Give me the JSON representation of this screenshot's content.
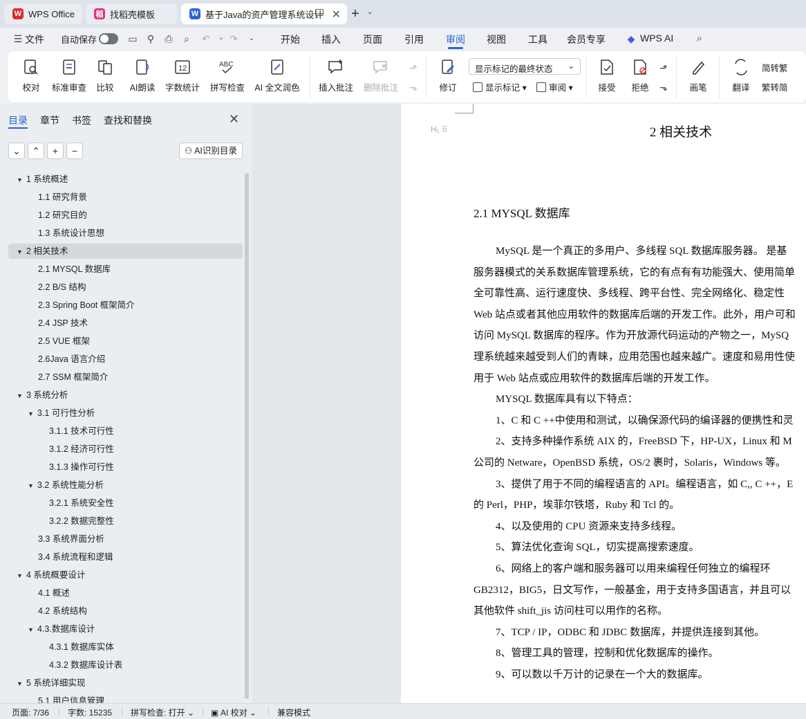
{
  "tabs": {
    "wps_office": "WPS Office",
    "templates": "找稻壳模板",
    "document": "基于Java的资产管理系统设计",
    "wps_color": "#e02b2b",
    "template_color": "#d9367a",
    "doc_color": "#2a64d8"
  },
  "menubar": {
    "file": "文件",
    "autosave": "自动保存",
    "items": [
      "开始",
      "插入",
      "页面",
      "引用",
      "审阅",
      "视图",
      "工具",
      "会员专享"
    ],
    "active": "审阅",
    "wps_ai": "WPS AI"
  },
  "ribbon": {
    "proofread": "校对",
    "standard_review": "标准审查",
    "compare": "比较",
    "ai_read": "AI朗读",
    "word_count": "字数统计",
    "spell_check": "拼写检查",
    "ai_polish": "AI 全文润色",
    "insert_comment": "插入批注",
    "delete_comment": "删除批注",
    "revise": "修订",
    "markup_dropdown": "显示标记的最终状态",
    "show_markup": "显示标记",
    "review_pane": "审阅",
    "accept": "接受",
    "reject": "拒绝",
    "pen": "画笔",
    "translate": "翻译",
    "to_traditional": "简转繁",
    "to_simplified": "繁转简"
  },
  "nav": {
    "tabs": [
      "目录",
      "章节",
      "书签",
      "查找和替换"
    ],
    "active_tab": "目录",
    "ai_toc": "AI识别目录",
    "toc": [
      {
        "level": 1,
        "text": "1 系统概述",
        "expand": true
      },
      {
        "level": 2,
        "text": "1.1  研究背景"
      },
      {
        "level": 2,
        "text": "1.2 研究目的"
      },
      {
        "level": 2,
        "text": "1.3 系统设计思想"
      },
      {
        "level": 1,
        "text": "2 相关技术",
        "expand": true,
        "selected": true
      },
      {
        "level": 2,
        "text": "2.1 MYSQL 数据库"
      },
      {
        "level": 2,
        "text": "2.2 B/S 结构"
      },
      {
        "level": 2,
        "text": "2.3 Spring Boot 框架简介"
      },
      {
        "level": 2,
        "text": "2.4 JSP 技术"
      },
      {
        "level": 2,
        "text": "2.5 VUE 框架"
      },
      {
        "level": 2,
        "text": "2.6Java 语言介绍"
      },
      {
        "level": 2,
        "text": "2.7 SSM 框架简介"
      },
      {
        "level": 1,
        "text": "3 系统分析",
        "expand": true
      },
      {
        "level": 2,
        "text": "3.1 可行性分析",
        "expand": true
      },
      {
        "level": 3,
        "text": "3.1.1 技术可行性"
      },
      {
        "level": 3,
        "text": "3.1.2 经济可行性"
      },
      {
        "level": 3,
        "text": "3.1.3 操作可行性"
      },
      {
        "level": 2,
        "text": "3.2 系统性能分析",
        "expand": true
      },
      {
        "level": 3,
        "text": "3.2.1  系统安全性"
      },
      {
        "level": 3,
        "text": "3.2.2  数据完整性"
      },
      {
        "level": 2,
        "text": "3.3 系统界面分析"
      },
      {
        "level": 2,
        "text": "3.4 系统流程和逻辑"
      },
      {
        "level": 1,
        "text": "4 系统概要设计",
        "expand": true
      },
      {
        "level": 2,
        "text": "4.1 概述"
      },
      {
        "level": 2,
        "text": "4.2 系统结构"
      },
      {
        "level": 2,
        "text": "4.3.数据库设计",
        "expand": true
      },
      {
        "level": 3,
        "text": "4.3.1 数据库实体"
      },
      {
        "level": 3,
        "text": "4.3.2 数据库设计表"
      },
      {
        "level": 1,
        "text": "5 系统详细实现",
        "expand": true
      },
      {
        "level": 2,
        "text": "5.1  用户信息管理"
      }
    ]
  },
  "document": {
    "chapter_title": "2 相关技术",
    "section_title": "2.1 MYSQL 数据库",
    "lines": [
      {
        "indent": true,
        "text": "MySQL 是一个真正的多用户、多线程 SQL 数据库服务器。 是基"
      },
      {
        "indent": false,
        "text": "服务器模式的关系数据库管理系统，它的有点有有功能强大、使用简单"
      },
      {
        "indent": false,
        "text": "全可靠性高、运行速度快、多线程、跨平台性、完全网络化、稳定性"
      },
      {
        "indent": false,
        "text": "Web 站点或者其他应用软件的数据库后端的开发工作。此外，用户可和"
      },
      {
        "indent": false,
        "text": "访问 MySQL 数据库的程序。作为开放源代码运动的产物之一，MySQ"
      },
      {
        "indent": false,
        "text": "理系统越来越受到人们的青睐，应用范围也越来越广。速度和易用性使"
      },
      {
        "indent": false,
        "text": "用于 Web 站点或应用软件的数据库后端的开发工作。"
      },
      {
        "indent": true,
        "text": "MYSQL 数据库具有以下特点："
      },
      {
        "indent": true,
        "text": "1、C 和 C ++中使用和测试，以确保源代码的编译器的便携性和灵"
      },
      {
        "indent": true,
        "text": "2、支持多种操作系统 AIX 的，FreeBSD 下，HP-UX，Linux 和 M"
      },
      {
        "indent": false,
        "text": "公司的 Netware，OpenBSD 系统，OS/2 裹时，Solaris，Windows 等。"
      },
      {
        "indent": true,
        "text": "3、提供了用于不同的编程语言的 API。编程语言，如 C,, C ++，E"
      },
      {
        "indent": false,
        "text": "的 Perl，PHP，埃菲尔铁塔，Ruby 和 Tcl 的。"
      },
      {
        "indent": true,
        "text": "4、以及使用的 CPU 资源来支持多线程。"
      },
      {
        "indent": true,
        "text": "5、算法优化查询 SQL，切实提高搜索速度。"
      },
      {
        "indent": true,
        "text": "6、网络上的客户端和服务器可以用来编程任何独立的编程环"
      },
      {
        "indent": false,
        "text": "GB2312，BIG5，日文写作，一般基金，用于支持多国语言，并且可以"
      },
      {
        "indent": false,
        "text": "其他软件 shift_jis 访问柱可以用作的名称。"
      },
      {
        "indent": true,
        "text": "7、TCP / IP，ODBC 和 JDBC 数据库，并提供连接到其他。"
      },
      {
        "indent": true,
        "text": "8、管理工具的管理，控制和优化数据库的操作。"
      },
      {
        "indent": true,
        "text": "9、可以数以千万计的记录在一个大的数据库。"
      }
    ]
  },
  "status": {
    "page": "页面: 7/36",
    "words": "字数: 15235",
    "spell": "拼写检查: 打开",
    "ai_proof": "AI 校对",
    "compat": "兼容模式"
  }
}
